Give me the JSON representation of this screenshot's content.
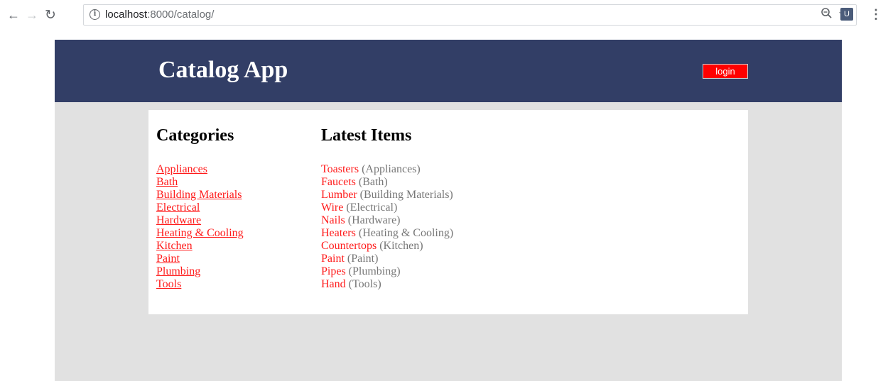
{
  "browser": {
    "url_host": "localhost",
    "url_path": ":8000/catalog/",
    "icons": [
      "back-icon",
      "forward-icon",
      "reload-icon",
      "info-icon",
      "zoom-icon",
      "star-icon",
      "extension-icon",
      "menu-icon"
    ]
  },
  "header": {
    "title": "Catalog App",
    "login_label": "login"
  },
  "categories": {
    "heading": "Categories",
    "items": [
      "Appliances",
      "Bath",
      "Building Materials",
      "Electrical",
      "Hardware",
      "Heating & Cooling",
      "Kitchen",
      "Paint",
      "Plumbing",
      "Tools"
    ]
  },
  "latest": {
    "heading": "Latest Items",
    "items": [
      {
        "name": "Toasters",
        "category": "(Appliances)"
      },
      {
        "name": "Faucets",
        "category": "(Bath)"
      },
      {
        "name": "Lumber",
        "category": "(Building Materials)"
      },
      {
        "name": "Wire",
        "category": "(Electrical)"
      },
      {
        "name": "Nails",
        "category": "(Hardware)"
      },
      {
        "name": "Heaters",
        "category": "(Heating & Cooling)"
      },
      {
        "name": "Countertops",
        "category": "(Kitchen)"
      },
      {
        "name": "Paint",
        "category": "(Paint)"
      },
      {
        "name": "Pipes",
        "category": "(Plumbing)"
      },
      {
        "name": "Hand",
        "category": "(Tools)"
      }
    ]
  },
  "colors": {
    "header_bg": "#323e66",
    "page_bg": "#e1e1e1",
    "link": "#ff1a1a",
    "login_bg": "#ff0000",
    "muted": "#777777"
  }
}
